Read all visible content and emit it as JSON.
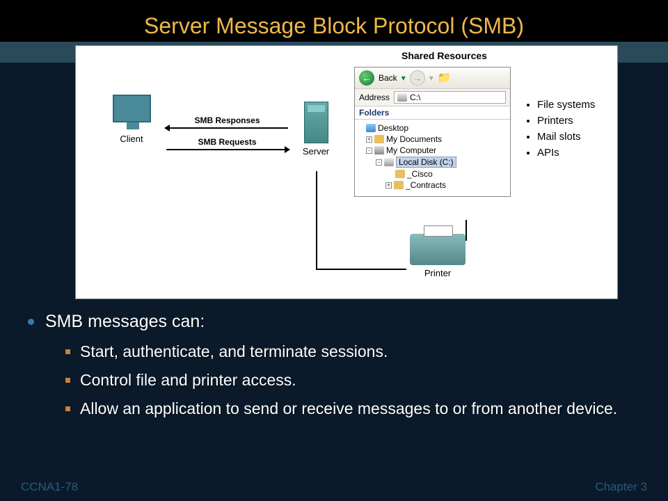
{
  "title": "Server Message Block Protocol (SMB)",
  "diagram": {
    "shared_title": "Shared Resources",
    "client_label": "Client",
    "server_label": "Server",
    "printer_label": "Printer",
    "arrow_top": "SMB Responses",
    "arrow_bottom": "SMB Requests",
    "explorer": {
      "back_label": "Back",
      "address_label": "Address",
      "address_value": "C:\\",
      "folders_label": "Folders",
      "tree": {
        "desktop": "Desktop",
        "my_documents": "My Documents",
        "my_computer": "My Computer",
        "local_disk": "Local Disk (C:)",
        "cisco": "_Cisco",
        "contracts": "_Contracts"
      }
    },
    "resources": [
      "File systems",
      "Printers",
      "Mail slots",
      "APIs"
    ]
  },
  "bullets": {
    "main": "SMB messages can:",
    "subs": [
      "Start, authenticate, and terminate sessions.",
      "Control file and printer access.",
      "Allow an application to send or receive messages to or from another device."
    ]
  },
  "footer": {
    "left": "CCNA1-78",
    "right": "Chapter 3"
  }
}
